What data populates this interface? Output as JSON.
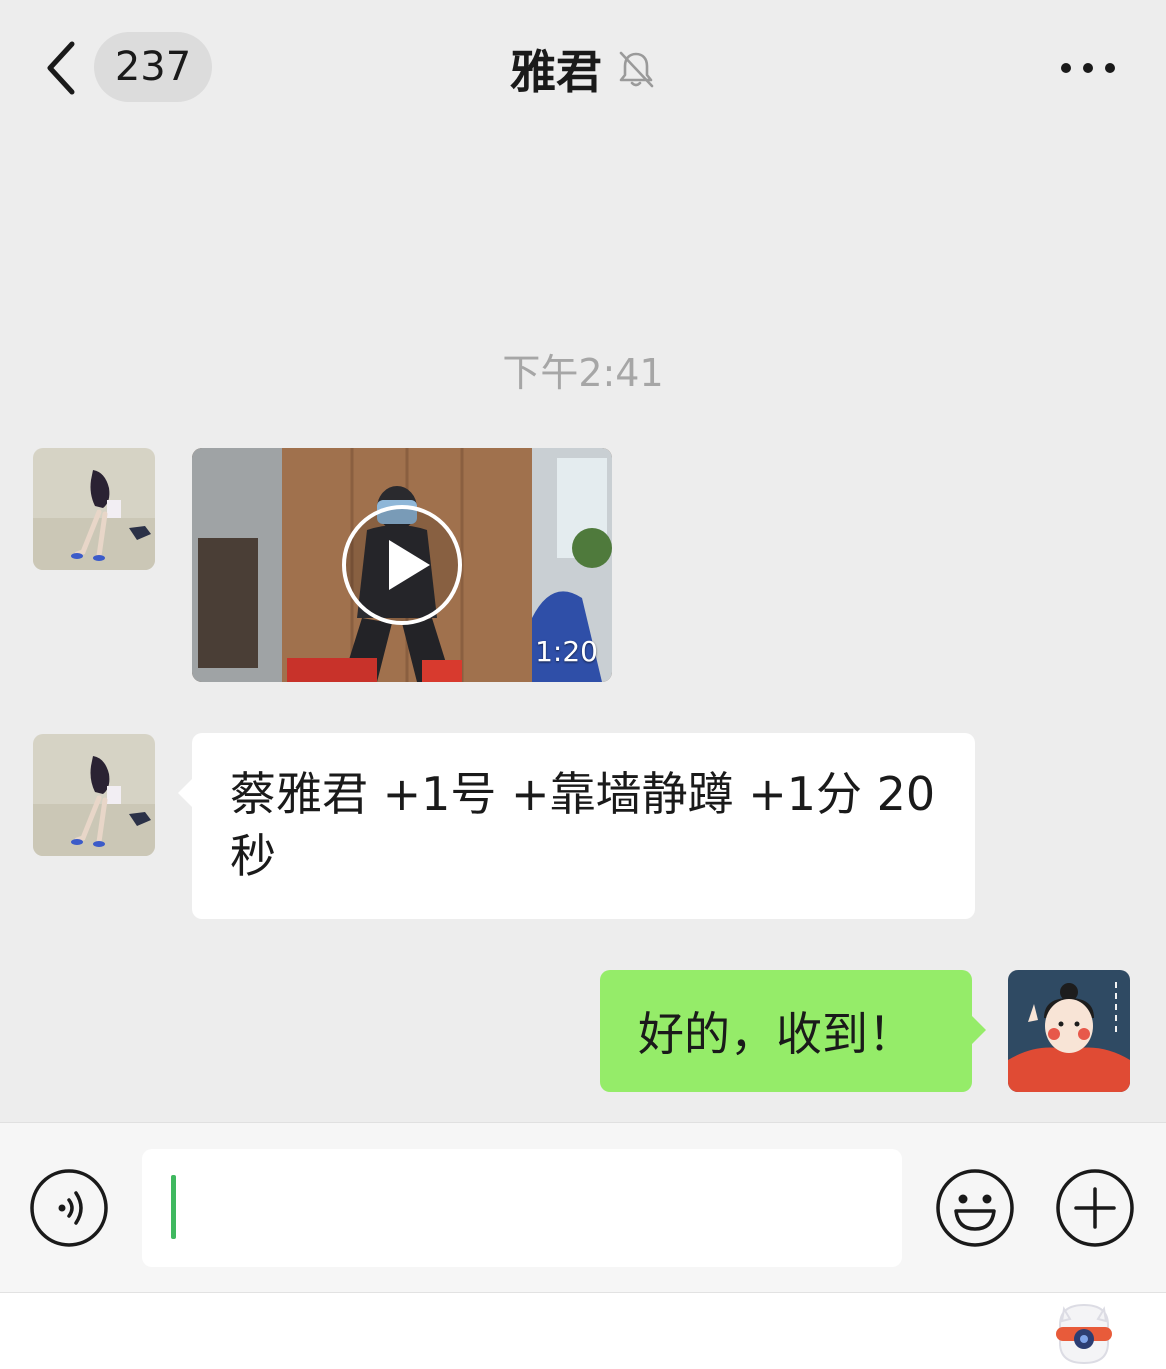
{
  "header": {
    "unread_count": "237",
    "title": "雅君",
    "back_icon": "chevron-left-icon",
    "mute_icon": "bell-off-icon",
    "more_icon": "more-dots-icon"
  },
  "messages": {
    "timestamp": "下午2:41",
    "video": {
      "duration": "1:20",
      "play_icon": "play-icon"
    },
    "incoming_text": "蔡雅君 +1号 +靠墙静蹲 +1分 20秒",
    "outgoing_text": "好的，收到！"
  },
  "input_bar": {
    "value": "",
    "voice_icon": "voice-icon",
    "emoji_icon": "emoji-icon",
    "plus_icon": "plus-icon"
  },
  "colors": {
    "background": "#ededed",
    "outgoing_bubble": "#95ec69",
    "incoming_bubble": "#ffffff",
    "caret": "#3fb85f"
  }
}
